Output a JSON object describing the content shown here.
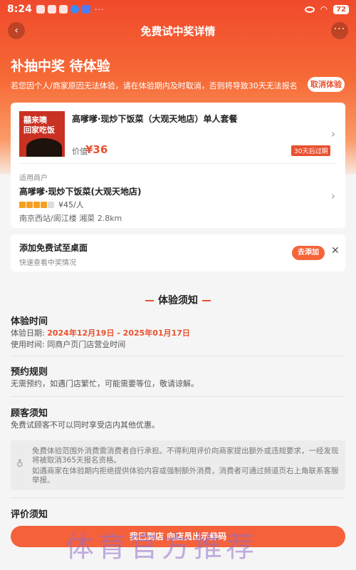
{
  "status_bar": {
    "time": "8:24",
    "battery": "72"
  },
  "nav": {
    "title": "免费试中奖详情",
    "back_icon": "‹",
    "more_icon": "···"
  },
  "hero": {
    "status_title": "补抽中奖 待体验",
    "notice": "若您因个人/商家原因无法体验，请在体验期内及时取消，否则将导致30天无法报名",
    "cancel_label": "取消体验"
  },
  "product": {
    "image_text": "囍来噢\n回家吃饭",
    "name": "高嗲嗲·现炒下饭菜（大观天地店）单人套餐",
    "value_label": "价值",
    "value_price": "¥36",
    "expiry_badge": "30天后过期"
  },
  "merchant": {
    "label": "适用商户",
    "name": "高嗲嗲·现炒下饭菜(大观天地店)",
    "rating": 4,
    "rating_max": 5,
    "avg_price": "¥45/人",
    "location": "南京西站/阆江楼  湘菜  2.8km"
  },
  "shortcut": {
    "title": "添加免费试至桌面",
    "subtitle": "快速查看中奖情况",
    "add_label": "去添加",
    "close_icon": "✕"
  },
  "rules": {
    "section_title": "体验须知",
    "time_heading": "体验时间",
    "date_label": "体验日期:",
    "date_value": "2024年12月19日 - 2025年01月17日",
    "hours_label": "使用时间:",
    "hours_value": "同商户页门店营业时间",
    "booking_heading": "预约规则",
    "booking_text": "无需预约，如遇门店繁忙，可能需要等位，敬请谅解。",
    "customer_heading": "顾客须知",
    "customer_text": "免费试顾客不可以同时享受店内其他优惠。",
    "tip_1": "免费体验范围外消费需消费者自行承担。不得利用评价向商家提出额外或违规要求，一经发现将被取消365天报名资格。",
    "tip_2": "如遇商家在体验期内拒绝提供体验内容或强制额外消费，消费者可通过频道页右上角联系客服举报。",
    "review_heading": "评价须知"
  },
  "bottom": {
    "button_label": "我已到店 向店员出示券码",
    "watermark": "体育官方推荐"
  },
  "colors": {
    "accent": "#e8512f",
    "button": "#f5613a",
    "star": "#f5a022"
  }
}
